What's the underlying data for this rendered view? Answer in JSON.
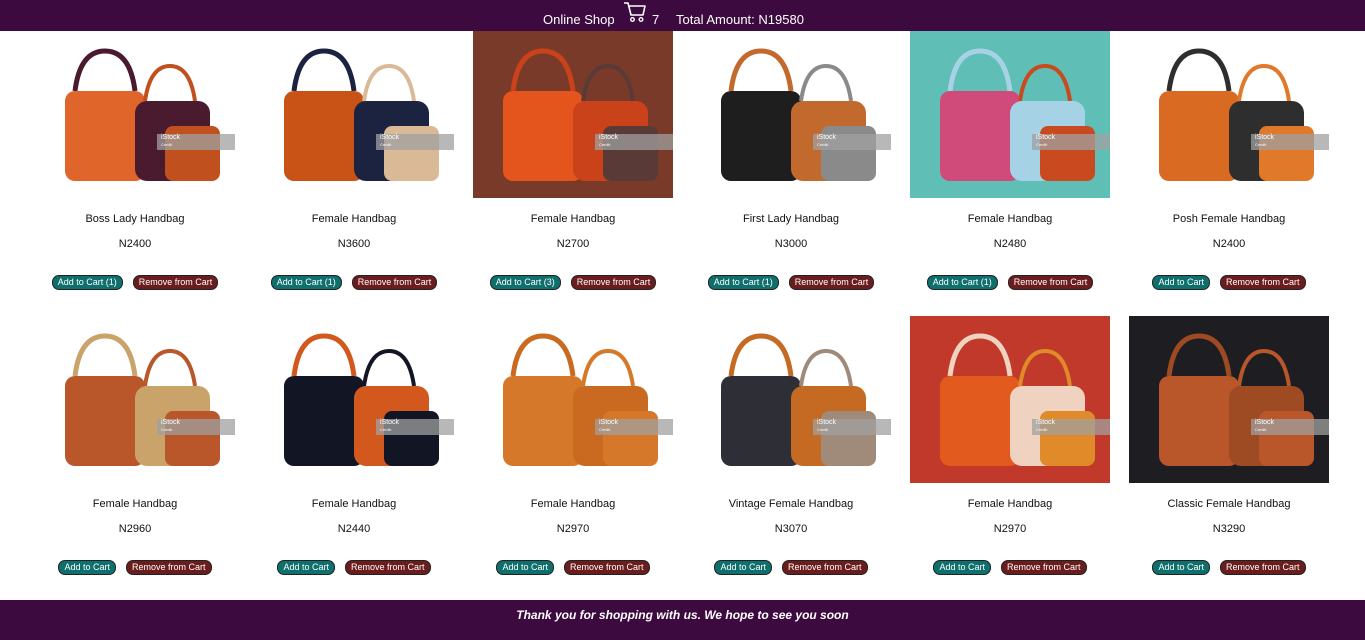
{
  "header": {
    "title": "Online Shop",
    "cart_icon": "cart-icon",
    "cart_count": "7",
    "total_amount_label": "Total Amount: N19580"
  },
  "watermark": {
    "brand": "iStock",
    "credit": "Credit:"
  },
  "products": [
    {
      "name": "Boss Lady Handbag",
      "price": "N2400",
      "add_label": "Add to Cart (1)",
      "remove_label": "Remove from Cart",
      "bg": "#ffffff",
      "colors": [
        "#e0652a",
        "#4a1a2f",
        "#c0501e"
      ]
    },
    {
      "name": "Female Handbag",
      "price": "N3600",
      "add_label": "Add to Cart (1)",
      "remove_label": "Remove from Cart",
      "bg": "#ffffff",
      "colors": [
        "#c95316",
        "#1c2340",
        "#d9b996"
      ]
    },
    {
      "name": "Female Handbag",
      "price": "N2700",
      "add_label": "Add to Cart (3)",
      "remove_label": "Remove from Cart",
      "bg": "#7a3a2a",
      "colors": [
        "#e4551e",
        "#c9421a",
        "#5a3a36"
      ]
    },
    {
      "name": "First Lady Handbag",
      "price": "N3000",
      "add_label": "Add to Cart (1)",
      "remove_label": "Remove from Cart",
      "bg": "#ffffff",
      "colors": [
        "#1e1e1e",
        "#c26a2e",
        "#8a8a8a"
      ]
    },
    {
      "name": "Female Handbag",
      "price": "N2480",
      "add_label": "Add to Cart (1)",
      "remove_label": "Remove from Cart",
      "bg": "#5fbeb6",
      "colors": [
        "#d04a7a",
        "#a6d2e6",
        "#c94a1e"
      ]
    },
    {
      "name": "Posh Female Handbag",
      "price": "N2400",
      "add_label": "Add to Cart",
      "remove_label": "Remove from Cart",
      "bg": "#ffffff",
      "colors": [
        "#d86a22",
        "#2e2e2e",
        "#e07a2a"
      ]
    },
    {
      "name": "Female Handbag",
      "price": "N2960",
      "add_label": "Add to Cart",
      "remove_label": "Remove from Cart",
      "bg": "#ffffff",
      "colors": [
        "#b9562a",
        "#c9a36a",
        "#b9562a"
      ]
    },
    {
      "name": "Female Handbag",
      "price": "N2440",
      "add_label": "Add to Cart",
      "remove_label": "Remove from Cart",
      "bg": "#ffffff",
      "colors": [
        "#121524",
        "#d2581e",
        "#121524"
      ]
    },
    {
      "name": "Female Handbag",
      "price": "N2970",
      "add_label": "Add to Cart",
      "remove_label": "Remove from Cart",
      "bg": "#ffffff",
      "colors": [
        "#d5782a",
        "#c96a20",
        "#d5782a"
      ]
    },
    {
      "name": "Vintage Female Handbag",
      "price": "N3070",
      "add_label": "Add to Cart",
      "remove_label": "Remove from Cart",
      "bg": "#ffffff",
      "colors": [
        "#2e2e36",
        "#c46a22",
        "#a08a7a"
      ]
    },
    {
      "name": "Female Handbag",
      "price": "N2970",
      "add_label": "Add to Cart",
      "remove_label": "Remove from Cart",
      "bg": "#c0392b",
      "colors": [
        "#e35a1e",
        "#f0d2c0",
        "#e08a2a"
      ]
    },
    {
      "name": "Classic Female Handbag",
      "price": "N3290",
      "add_label": "Add to Cart",
      "remove_label": "Remove from Cart",
      "bg": "#1e1e22",
      "colors": [
        "#b9562a",
        "#9e4a22",
        "#b9562a"
      ]
    }
  ],
  "footer": {
    "text": "Thank you for shopping with us. We hope to see you soon"
  },
  "colors": {
    "brand": "#3d0a3f",
    "add_button": "#0f6f6d",
    "remove_button": "#6b1d1d"
  }
}
